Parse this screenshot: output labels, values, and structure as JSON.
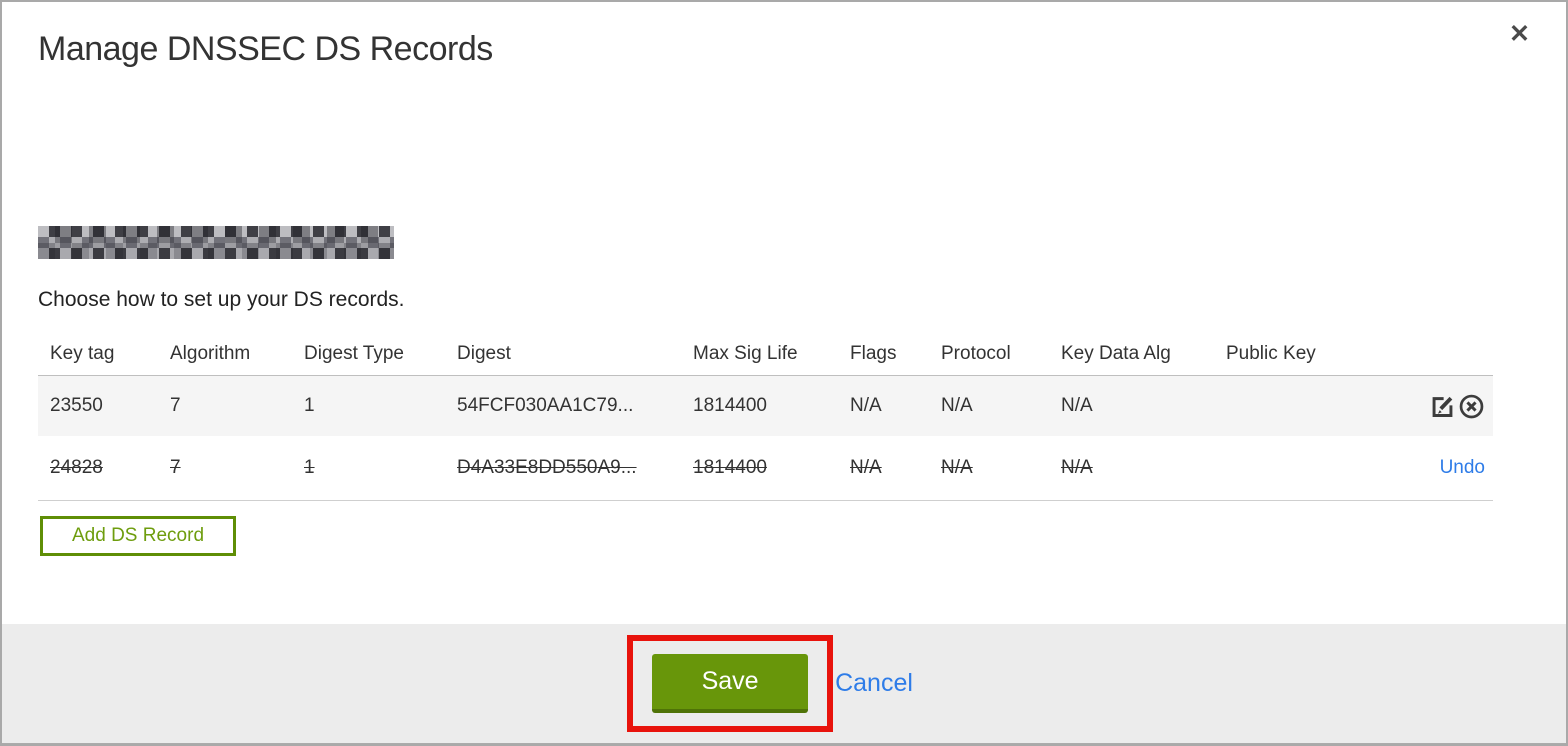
{
  "modal": {
    "title": "Manage DNSSEC DS Records",
    "close_glyph": "✕",
    "subtitle": "Choose how to set up your DS records."
  },
  "table": {
    "headers": [
      "Key tag",
      "Algorithm",
      "Digest Type",
      "Digest",
      "Max Sig Life",
      "Flags",
      "Protocol",
      "Key Data Alg",
      "Public Key"
    ],
    "rows": [
      {
        "key_tag": "23550",
        "algorithm": "7",
        "digest_type": "1",
        "digest": "54FCF030AA1C79...",
        "max_sig_life": "1814400",
        "flags": "N/A",
        "protocol": "N/A",
        "key_data_alg": "N/A",
        "public_key": "",
        "state": "active",
        "actions": [
          "edit",
          "delete"
        ]
      },
      {
        "key_tag": "24828",
        "algorithm": "7",
        "digest_type": "1",
        "digest": "D4A33E8DD550A9...",
        "max_sig_life": "1814400",
        "flags": "N/A",
        "protocol": "N/A",
        "key_data_alg": "N/A",
        "public_key": "",
        "state": "marked-for-deletion",
        "undo_label": "Undo"
      }
    ]
  },
  "buttons": {
    "add_ds_record": "Add DS Record",
    "save": "Save",
    "cancel": "Cancel"
  },
  "annotation": {
    "type": "highlight-box",
    "color": "#e8130c",
    "target": "save-button"
  },
  "colors": {
    "save_green": "#68960a",
    "save_green_dark": "#4f7307",
    "add_button_green": "#5f8e06",
    "link_blue": "#2e7ce8",
    "row_stripe": "#f5f5f5",
    "footer_gray": "#ececec",
    "annotation_red": "#e8130c"
  }
}
